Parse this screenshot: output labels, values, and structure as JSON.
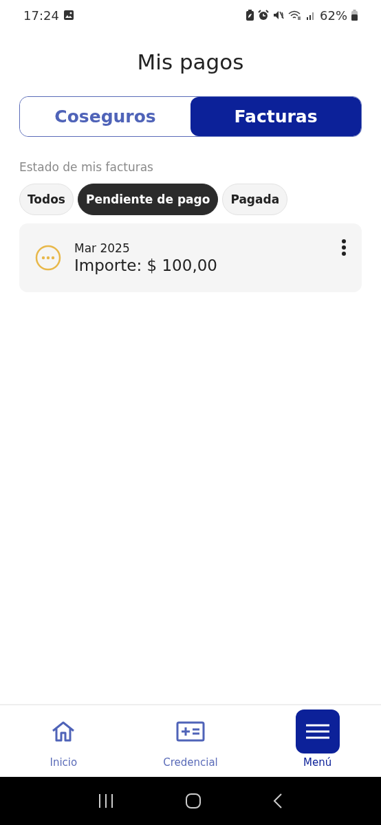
{
  "status_bar": {
    "time": "17:24",
    "battery": "62%"
  },
  "title": "Mis pagos",
  "tabs": [
    {
      "label": "Coseguros",
      "selected": false
    },
    {
      "label": "Facturas",
      "selected": true
    }
  ],
  "filter_label": "Estado de mis facturas",
  "filters": [
    {
      "label": "Todos",
      "selected": false
    },
    {
      "label": "Pendiente de pago",
      "selected": true
    },
    {
      "label": "Pagada",
      "selected": false
    }
  ],
  "invoices": [
    {
      "kind": "pending",
      "period": "Mar 2025",
      "amount": "Importe: $ 100,00"
    }
  ],
  "bottom_nav": [
    {
      "kind": "home",
      "label": "Inicio",
      "selected": false
    },
    {
      "kind": "card",
      "label": "Credencial",
      "selected": false
    },
    {
      "kind": "menu",
      "label": "Menú",
      "selected": true
    }
  ]
}
